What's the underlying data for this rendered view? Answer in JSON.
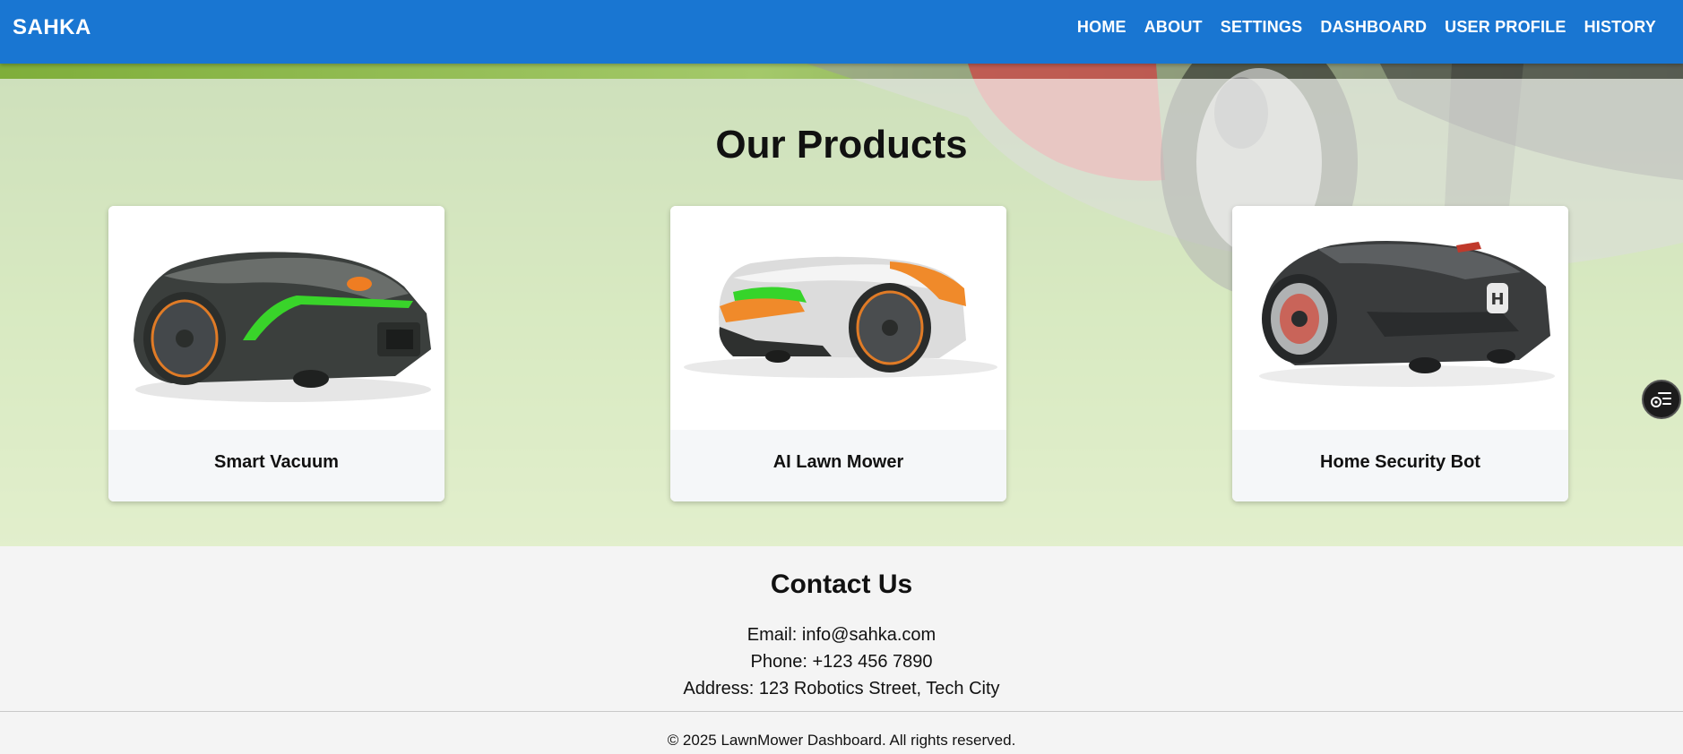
{
  "header": {
    "brand": "SAHKA",
    "nav": [
      "HOME",
      "ABOUT",
      "SETTINGS",
      "DASHBOARD",
      "USER PROFILE",
      "HISTORY"
    ],
    "color": "#1976d2"
  },
  "products": {
    "title": "Our Products",
    "items": [
      {
        "name": "Smart Vacuum",
        "image": "green-lit-robot-mower"
      },
      {
        "name": "AI Lawn Mower",
        "image": "orange-white-robot-mower"
      },
      {
        "name": "Home Security Bot",
        "image": "dark-grey-robot-mower"
      }
    ]
  },
  "floating_button": {
    "icon": "menu-list-icon"
  },
  "contact": {
    "title": "Contact Us",
    "email": "Email: info@sahka.com",
    "phone": "Phone: +123 456 7890",
    "address": "Address: 123 Robotics Street, Tech City"
  },
  "footer": {
    "copyright": "© 2025 LawnMower Dashboard. All rights reserved."
  }
}
